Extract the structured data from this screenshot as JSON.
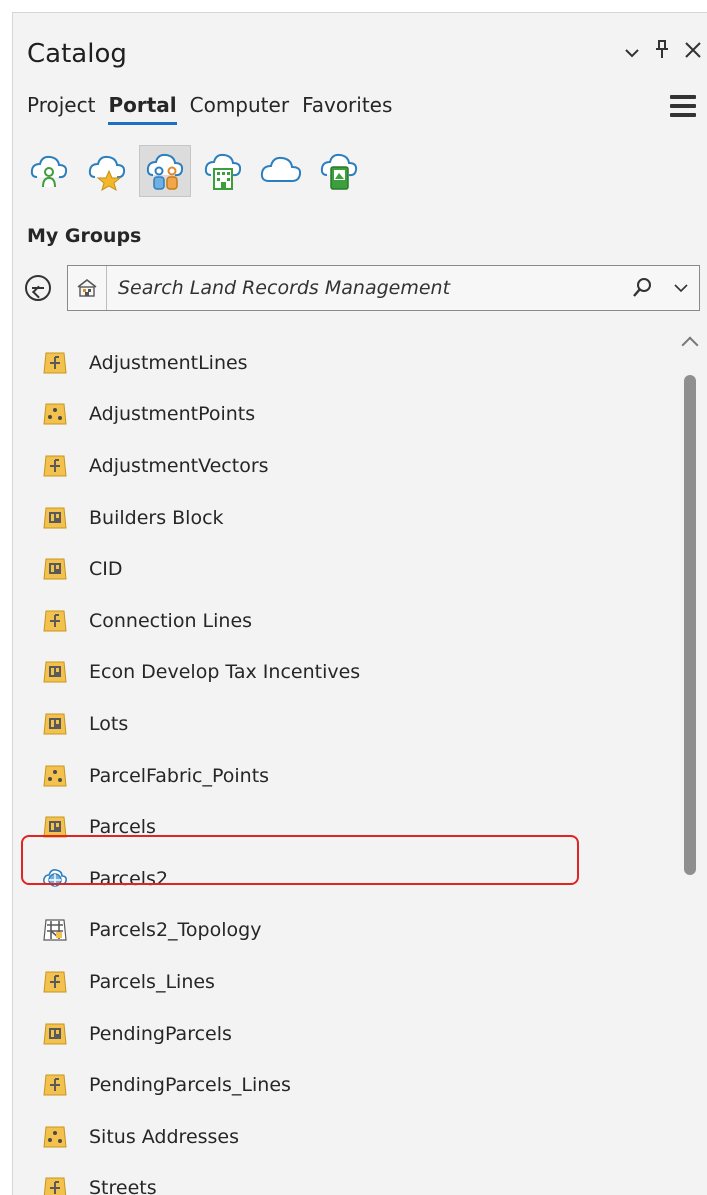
{
  "pane": {
    "title": "Catalog",
    "controls": [
      "⌄",
      "⊥",
      "✕"
    ]
  },
  "tabs": [
    {
      "label": "Project",
      "active": false
    },
    {
      "label": "Portal",
      "active": true
    },
    {
      "label": "Computer",
      "active": false
    },
    {
      "label": "Favorites",
      "active": false
    }
  ],
  "portal_icons": [
    {
      "name": "my-content-icon",
      "selected": false
    },
    {
      "name": "my-favorites-icon",
      "selected": false
    },
    {
      "name": "my-groups-icon",
      "selected": true
    },
    {
      "name": "my-organization-icon",
      "selected": false
    },
    {
      "name": "arcgis-online-icon",
      "selected": false
    },
    {
      "name": "living-atlas-icon",
      "selected": false
    }
  ],
  "section_title": "My Groups",
  "search": {
    "placeholder": "Search Land Records Management"
  },
  "items": [
    {
      "label": "AdjustmentLines",
      "icon": "line-layer-icon"
    },
    {
      "label": "AdjustmentPoints",
      "icon": "point-layer-icon"
    },
    {
      "label": "AdjustmentVectors",
      "icon": "line-layer-icon"
    },
    {
      "label": "Builders Block",
      "icon": "polygon-layer-icon"
    },
    {
      "label": "CID",
      "icon": "polygon-layer-icon"
    },
    {
      "label": "Connection Lines",
      "icon": "line-layer-icon"
    },
    {
      "label": "Econ Develop Tax Incentives",
      "icon": "polygon-layer-icon"
    },
    {
      "label": "Lots",
      "icon": "polygon-layer-icon"
    },
    {
      "label": "ParcelFabric_Points",
      "icon": "point-layer-icon"
    },
    {
      "label": "Parcels",
      "icon": "polygon-layer-icon"
    },
    {
      "label": "Parcels2",
      "icon": "service-icon"
    },
    {
      "label": "Parcels2_Topology",
      "icon": "topology-icon"
    },
    {
      "label": "Parcels_Lines",
      "icon": "line-layer-icon"
    },
    {
      "label": "PendingParcels",
      "icon": "polygon-layer-icon"
    },
    {
      "label": "PendingParcels_Lines",
      "icon": "line-layer-icon"
    },
    {
      "label": "Situs Addresses",
      "icon": "point-layer-icon"
    },
    {
      "label": "Streets",
      "icon": "line-layer-icon"
    }
  ],
  "highlighted_item": "Parcels2",
  "colors": {
    "accent": "#1e6fc3",
    "highlight": "#e02424",
    "layer_fill": "#f2c14e"
  }
}
